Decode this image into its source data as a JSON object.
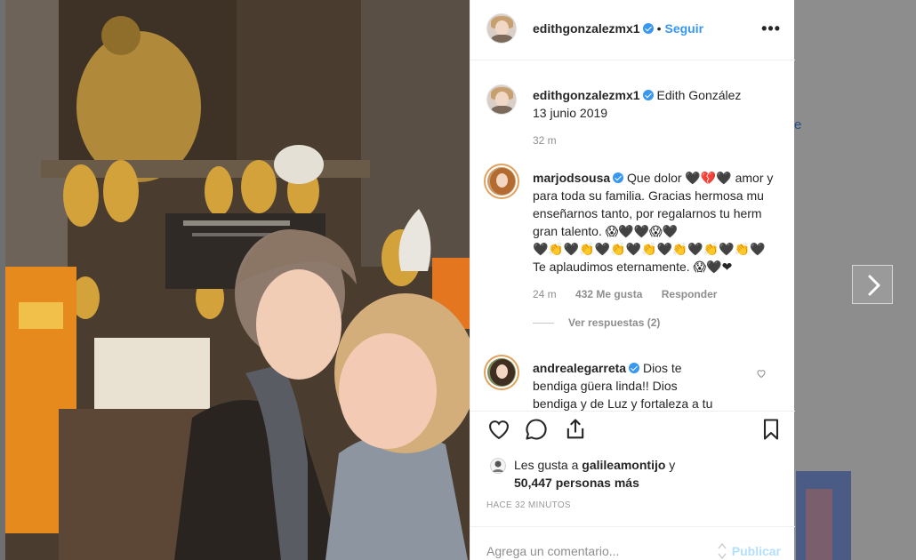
{
  "header": {
    "username": "edithgonzalezmx1",
    "separator": "•",
    "follow_label": "Seguir",
    "more_label": "•••"
  },
  "caption": {
    "username": "edithgonzalezmx1",
    "text": "Edith González",
    "date": "13 junio 2019",
    "time": "32 m"
  },
  "comments": [
    {
      "username": "marjodsousa",
      "lines": [
        "Que dolor 🖤💔🖤 amor y",
        "para toda su familia. Gracias hermosa mu",
        "enseñarnos tanto, por regalarnos tu herm",
        "gran talento. 😱🖤🖤😱🖤",
        "🖤👏🖤👏🖤👏🖤👏🖤👏🖤👏🖤👏🖤",
        "Te aplaudimos eternamente. 😱🖤❤"
      ],
      "time": "24 m",
      "likes": "432 Me gusta",
      "reply": "Responder",
      "view_replies": "Ver respuestas (2)"
    },
    {
      "username": "andrealegarreta",
      "lines": [
        "Dios te",
        "bendiga güera linda!! Dios",
        "bendiga y de Luz y fortaleza a tu"
      ]
    }
  ],
  "likes": {
    "prefix": "Les gusta a",
    "user": "galileamontijo",
    "conj": "y",
    "count": "50,447 personas más"
  },
  "timestamp": "HACE 32 MINUTOS",
  "add_comment": {
    "placeholder": "Agrega un comentario...",
    "publish_label": "Publicar"
  },
  "background": {
    "link_fragment": "e"
  },
  "colors": {
    "accent": "#3897f0",
    "publish_disabled": "#b2dffc",
    "muted": "#8e8e8e"
  }
}
